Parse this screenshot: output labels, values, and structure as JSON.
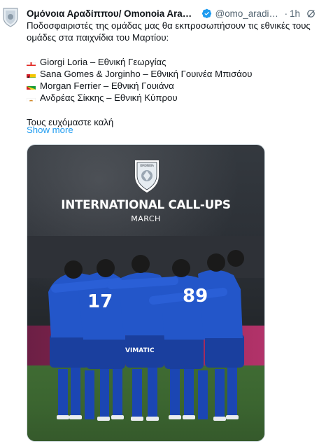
{
  "tweet": {
    "display_name": "Ομόνοια Αραδίππου/ Omonoia Aradip...",
    "handle": "@omo_aradipp...",
    "separator": "·",
    "time": "1h",
    "lines": [
      "Ποδοσφαιριστές της ομάδας μας θα εκπροσωπήσουν τις εθνικές τους",
      "ομάδες στα παιχνίδια του Μαρτίου:"
    ],
    "callups": [
      {
        "flag": "georgia-flag",
        "text": "Giorgi Loria – Εθνική Γεωργίας"
      },
      {
        "flag": "guinea-bissau-flag",
        "text": "Sana Gomes & Jorginho – Εθνική Γουινέα Μπισάου"
      },
      {
        "flag": "guyana-flag",
        "text": "Morgan Ferrier – Εθνική Γουιάνα"
      },
      {
        "flag": "cyprus-flag",
        "text": "Ανδρέας Σίκκης – Εθνική Κύπρου"
      }
    ],
    "closing": "Τους ευχόμαστε καλή",
    "show_more": "Show more"
  },
  "media": {
    "headline": "INTERNATIONAL CALL-UPS",
    "subline": "MARCH",
    "crest_text": "OMONOIA",
    "shirt_numbers": [
      "17",
      "89"
    ],
    "sponsor": "VIMATIC"
  },
  "colors": {
    "link": "#1d9bf0",
    "verified": "#1d9bf0",
    "secondary_text": "#536471",
    "kit_blue": "#1f4fbf"
  }
}
